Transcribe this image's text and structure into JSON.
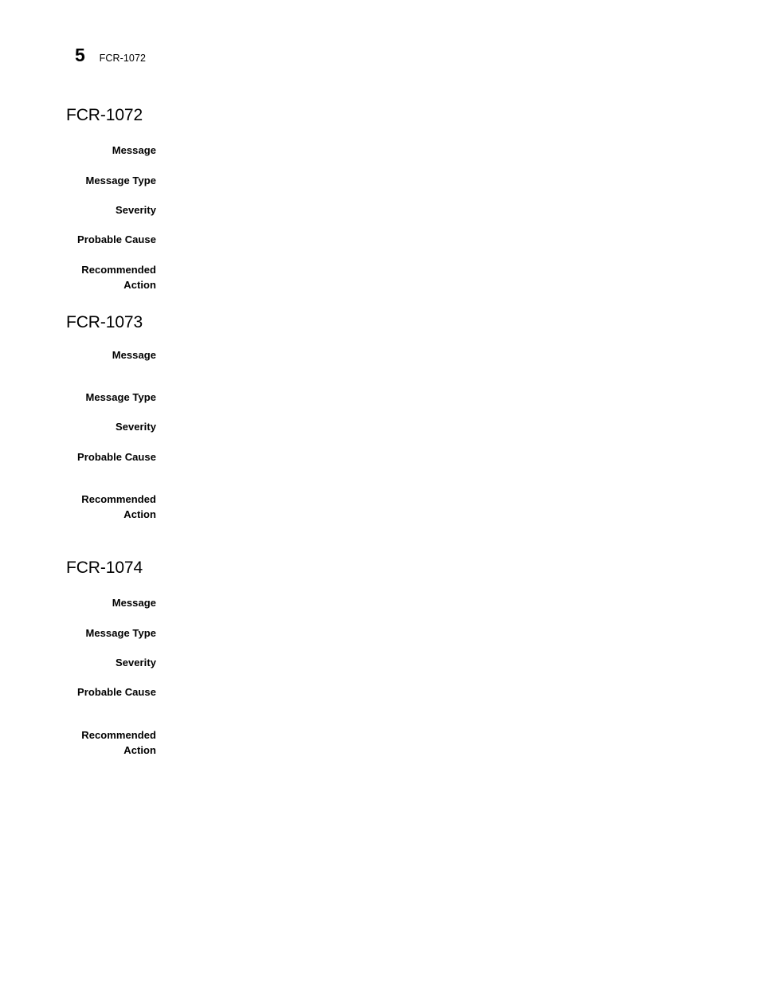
{
  "header": {
    "page_number": "5",
    "chapter_label": "FCR-1072"
  },
  "labels": {
    "message": "Message",
    "message_type": "Message Type",
    "severity": "Severity",
    "probable_cause": "Probable Cause",
    "recommended_action": "Recommended\nAction"
  },
  "sections": [
    {
      "title": "FCR-1072",
      "fields": [
        {
          "label": "Message",
          "value": ""
        },
        {
          "label": "Message Type",
          "value": ""
        },
        {
          "label": "Severity",
          "value": ""
        },
        {
          "label": "Probable Cause",
          "value": ""
        },
        {
          "label": "Recommended\nAction",
          "value": ""
        }
      ]
    },
    {
      "title": "FCR-1073",
      "fields": [
        {
          "label": "Message",
          "value": ""
        },
        {
          "label": "Message Type",
          "value": ""
        },
        {
          "label": "Severity",
          "value": ""
        },
        {
          "label": "Probable Cause",
          "value": ""
        },
        {
          "label": "Recommended\nAction",
          "value": ""
        }
      ]
    },
    {
      "title": "FCR-1074",
      "fields": [
        {
          "label": "Message",
          "value": ""
        },
        {
          "label": "Message Type",
          "value": ""
        },
        {
          "label": "Severity",
          "value": ""
        },
        {
          "label": "Probable Cause",
          "value": ""
        },
        {
          "label": "Recommended\nAction",
          "value": ""
        }
      ]
    }
  ],
  "layout": {
    "section_tops": [
      133,
      393,
      701
    ],
    "row_tops": [
      [
        47,
        85,
        122,
        159,
        197
      ],
      [
        44,
        97,
        134,
        172,
        225
      ],
      [
        47,
        85,
        122,
        159,
        213
      ]
    ]
  }
}
